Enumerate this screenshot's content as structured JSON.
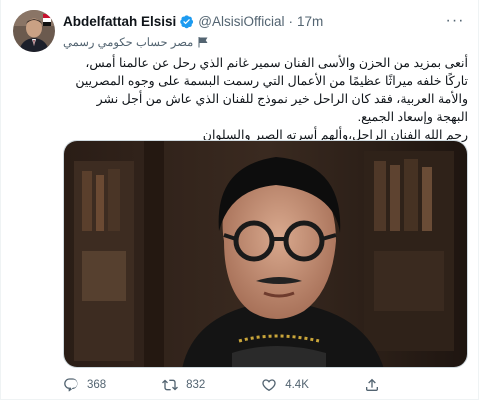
{
  "tweet": {
    "author": {
      "display_name": "Abdelfattah Elsisi",
      "handle": "@AlsisiOfficial",
      "verified": true,
      "verified_color": "#1d9bf0"
    },
    "separator": "·",
    "time": "17m",
    "more_label": "···",
    "account_label": "مصر حساب حكومي رسمي",
    "text_lines": [
      "أنعى بمزيد من الحزن والأسى الفنان سمير غانم الذي رحل عن عالمنا أمس، تاركًا خلفه ميراثًا عظيمًا من الأعمال التي رسمت البسمة على وجوه المصريين والأمة العربية، فقد كان الراحل خير نموذج للفنان الذي عاش من أجل نشر البهجة وإسعاد الجميع.",
      "رحم الله الفنان الراحل،وألهم أسرته الصبر والسلوان"
    ],
    "actions": {
      "reply_count": "368",
      "retweet_count": "832",
      "like_count": "4.4K",
      "share_label": ""
    }
  }
}
